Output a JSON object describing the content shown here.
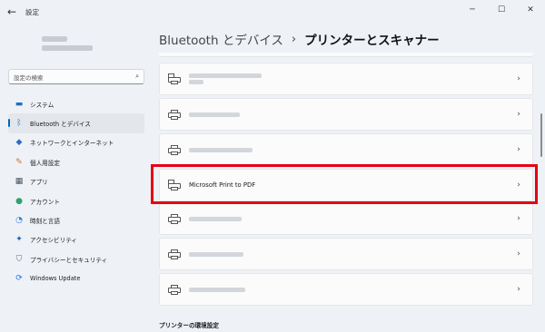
{
  "window": {
    "app_title": "設定",
    "back_glyph": "←",
    "minimize_glyph": "─",
    "maximize_glyph": "☐",
    "close_glyph": "✕"
  },
  "search": {
    "placeholder": "設定の検索",
    "icon": "search-icon",
    "glyph": "⌕"
  },
  "sidebar": {
    "items": [
      {
        "label": "システム",
        "icon": "monitor-icon",
        "glyph": "▬",
        "color": "#1e6fc2",
        "active": false
      },
      {
        "label": "Bluetooth とデバイス",
        "icon": "bluetooth-icon",
        "glyph": "ᛒ",
        "color": "#1a73e8",
        "active": true
      },
      {
        "label": "ネットワークとインターネット",
        "icon": "wifi-icon",
        "glyph": "◆",
        "color": "#2b6cc4",
        "active": false
      },
      {
        "label": "個人用設定",
        "icon": "brush-icon",
        "glyph": "✎",
        "color": "#d96b1e",
        "active": false
      },
      {
        "label": "アプリ",
        "icon": "apps-icon",
        "glyph": "▦",
        "color": "#4a5563",
        "active": false
      },
      {
        "label": "アカウント",
        "icon": "account-icon",
        "glyph": "●",
        "color": "#2fa36b",
        "active": false
      },
      {
        "label": "時刻と言語",
        "icon": "globe-clock-icon",
        "glyph": "◔",
        "color": "#2a7bd1",
        "active": false
      },
      {
        "label": "アクセシビリティ",
        "icon": "accessibility-icon",
        "glyph": "✦",
        "color": "#1a5fb4",
        "active": false
      },
      {
        "label": "プライバシーとセキュリティ",
        "icon": "shield-icon",
        "glyph": "⛉",
        "color": "#5f6b78",
        "active": false
      },
      {
        "label": "Windows Update",
        "icon": "windows-update-icon",
        "glyph": "⟳",
        "color": "#1a73e8",
        "active": false
      }
    ]
  },
  "breadcrumb": {
    "parent": "Bluetooth とデバイス",
    "separator": "›",
    "current": "プリンターとスキャナー"
  },
  "printers": [
    {
      "name": "",
      "icon": "printer-doc-icon"
    },
    {
      "name": "",
      "icon": "printer-icon"
    },
    {
      "name": "",
      "icon": "printer-icon"
    },
    {
      "name": "Microsoft Print to PDF",
      "icon": "printer-doc-icon"
    },
    {
      "name": "",
      "icon": "printer-icon"
    },
    {
      "name": "",
      "icon": "printer-icon"
    },
    {
      "name": "",
      "icon": "printer-icon"
    }
  ],
  "chevron_glyph": "›",
  "section_label": "プリンターの環境設定",
  "highlight_color": "#e60012"
}
